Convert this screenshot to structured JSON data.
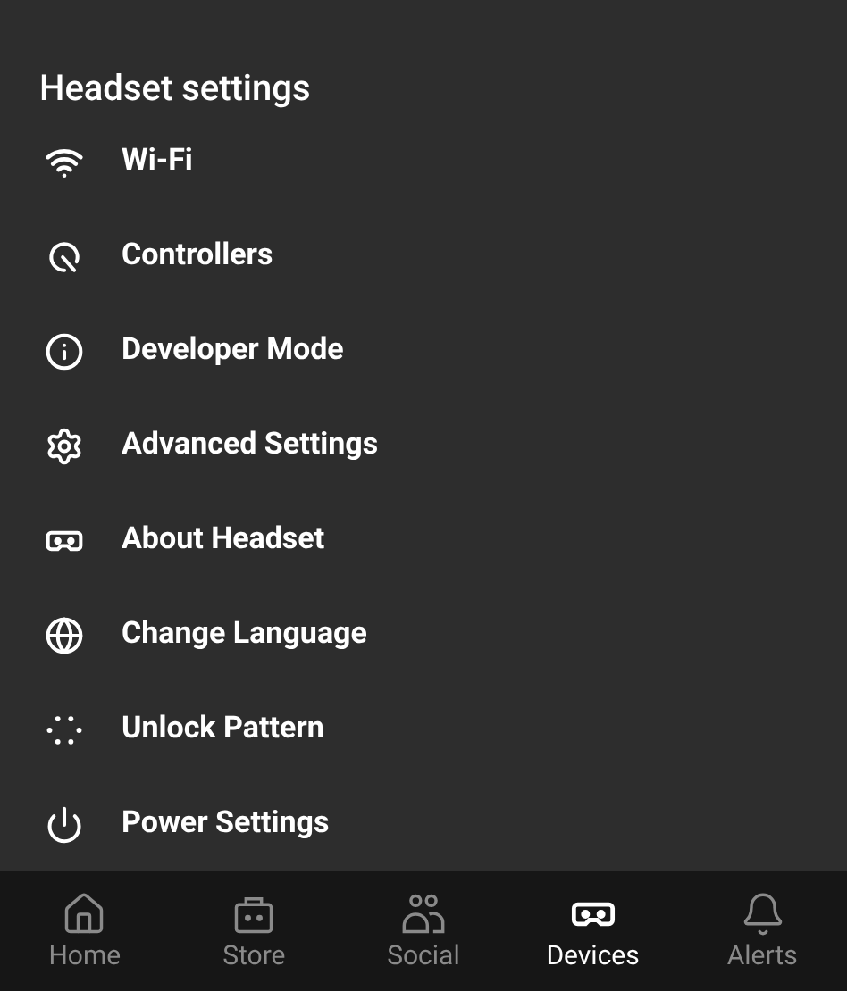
{
  "title": "Headset settings",
  "items": [
    {
      "label": "Wi-Fi"
    },
    {
      "label": "Controllers"
    },
    {
      "label": "Developer Mode"
    },
    {
      "label": "Advanced Settings"
    },
    {
      "label": "About Headset"
    },
    {
      "label": "Change Language"
    },
    {
      "label": "Unlock Pattern"
    },
    {
      "label": "Power Settings"
    }
  ],
  "nav": [
    {
      "label": "Home",
      "selected": false
    },
    {
      "label": "Store",
      "selected": false
    },
    {
      "label": "Social",
      "selected": false
    },
    {
      "label": "Devices",
      "selected": true
    },
    {
      "label": "Alerts",
      "selected": false
    }
  ]
}
